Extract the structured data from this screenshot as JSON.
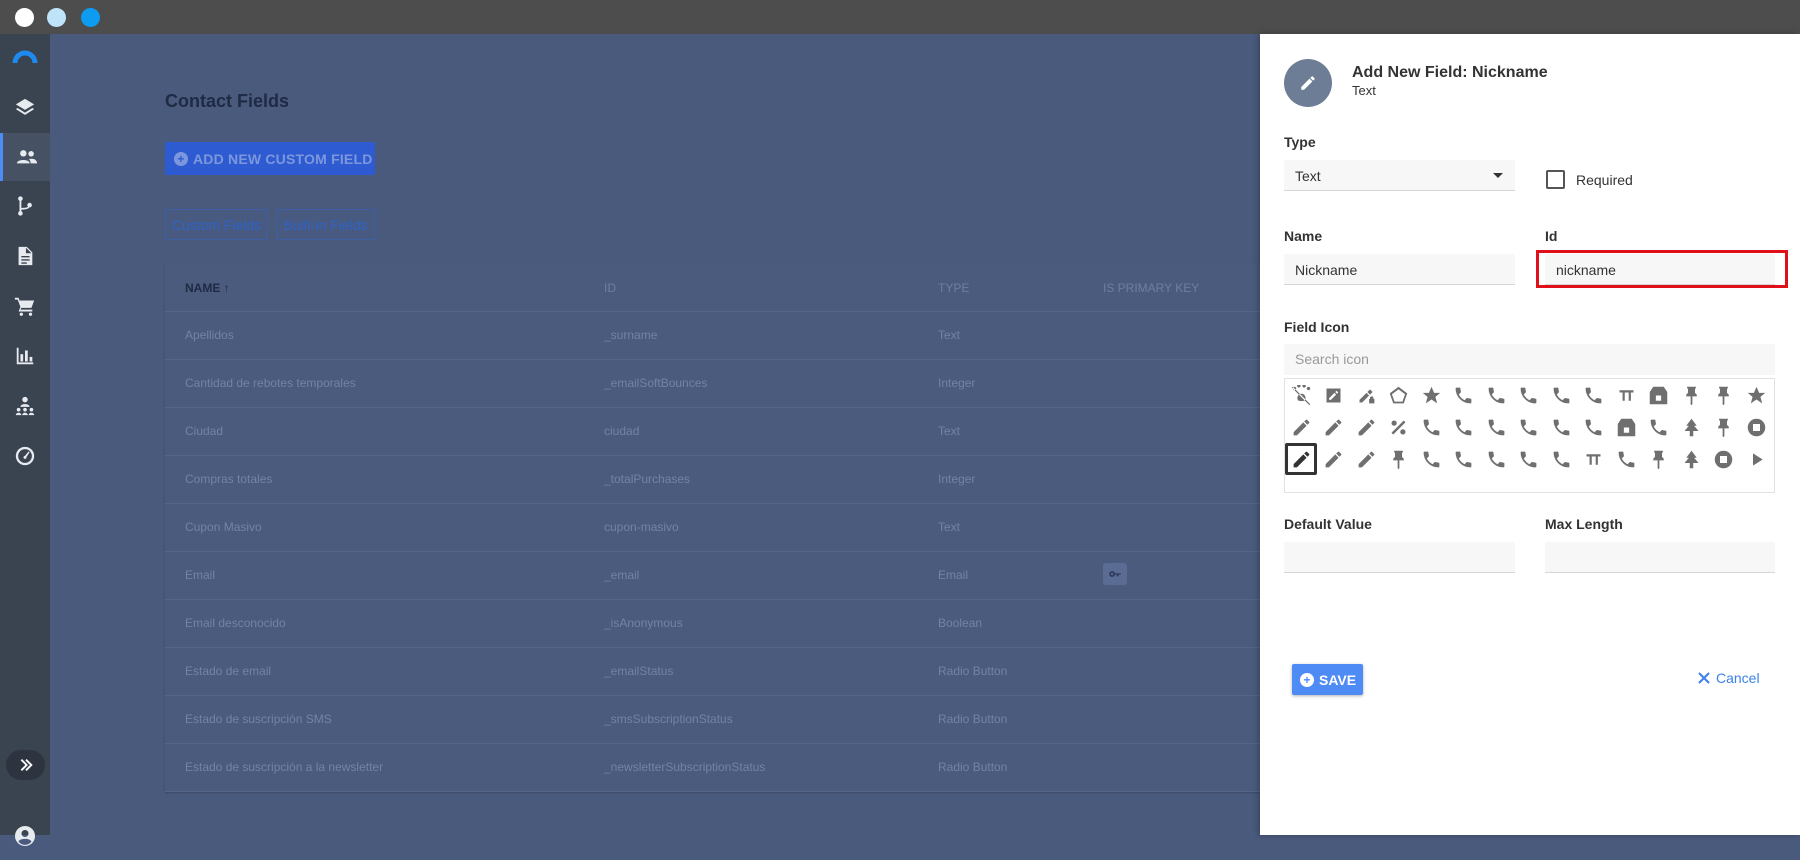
{
  "window": {
    "controls": [
      "close",
      "minimize",
      "maximize"
    ]
  },
  "sidebar": {
    "items": [
      {
        "name": "brand-logo",
        "icon": "logo-arc"
      },
      {
        "name": "sidebar-item-layers",
        "icon": "layers-icon"
      },
      {
        "name": "sidebar-item-contacts",
        "icon": "people-icon",
        "active": true
      },
      {
        "name": "sidebar-item-flows",
        "icon": "branch-icon"
      },
      {
        "name": "sidebar-item-documents",
        "icon": "document-icon"
      },
      {
        "name": "sidebar-item-shop",
        "icon": "cart-icon"
      },
      {
        "name": "sidebar-item-reports",
        "icon": "bar-chart-icon"
      },
      {
        "name": "sidebar-item-audience",
        "icon": "audience-icon"
      },
      {
        "name": "sidebar-item-dashboard",
        "icon": "gauge-icon"
      }
    ]
  },
  "page": {
    "title": "Contact Fields",
    "add_button": "ADD NEW CUSTOM FIELD",
    "tabs": [
      "Custom Fields",
      "Built-in Fields"
    ]
  },
  "table": {
    "headers": {
      "name": "NAME",
      "id": "ID",
      "type": "TYPE",
      "primary": "IS PRIMARY KEY"
    },
    "rows": [
      {
        "name": "Apellidos",
        "id": "_surname",
        "type": "Text",
        "primary": false
      },
      {
        "name": "Cantidad de rebotes temporales",
        "id": "_emailSoftBounces",
        "type": "Integer",
        "primary": false
      },
      {
        "name": "Ciudad",
        "id": "ciudad",
        "type": "Text",
        "primary": false
      },
      {
        "name": "Compras totales",
        "id": "_totalPurchases",
        "type": "Integer",
        "primary": false
      },
      {
        "name": "Cupon Masivo",
        "id": "cupon-masivo",
        "type": "Text",
        "primary": false
      },
      {
        "name": "Email",
        "id": "_email",
        "type": "Email",
        "primary": true
      },
      {
        "name": "Email desconocido",
        "id": "_isAnonymous",
        "type": "Boolean",
        "primary": false
      },
      {
        "name": "Estado de email",
        "id": "_emailStatus",
        "type": "Radio Button",
        "primary": false
      },
      {
        "name": "Estado de suscripción SMS",
        "id": "_smsSubscriptionStatus",
        "type": "Radio Button",
        "primary": false
      },
      {
        "name": "Estado de suscripción a la newsletter",
        "id": "_newsletterSubscriptionStatus",
        "type": "Radio Button",
        "primary": false
      }
    ]
  },
  "panel": {
    "title": "Add New Field: Nickname",
    "subtitle": "Text",
    "type_label": "Type",
    "type_value": "Text",
    "required_label": "Required",
    "name_label": "Name",
    "name_value": "Nickname",
    "id_label": "Id",
    "id_value": "nickname",
    "field_icon_label": "Field Icon",
    "search_placeholder": "Search icon",
    "icons": [
      "pets-off",
      "edit-box",
      "pen-lock",
      "pentagon-outline",
      "passport",
      "phone-classic",
      "phone-sync",
      "phone-log",
      "phone-outgoing",
      "phone-in-talk",
      "pi-box",
      "pill",
      "pin-off",
      "pinterest",
      "pizza",
      "partial",
      "pen",
      "edit-box-outline",
      "pen-off",
      "percent",
      "phone",
      "phone-forward",
      "phone-incoming",
      "phone-minus",
      "phone-paused",
      "phone-voip",
      "piano",
      "pillar",
      "pine-tree",
      "pinterest-box",
      "police-badge",
      "partial",
      "pencil",
      "pencil-off",
      "pentagon",
      "pin-marker",
      "phone-bluetooth",
      "phone-hangup",
      "phone-lock",
      "phone-missed",
      "phone-plus",
      "pi",
      "piggy-bank",
      "pin",
      "pine-tree-box",
      "pistol",
      "play",
      "partial"
    ],
    "selected_icon": "pencil",
    "default_value_label": "Default Value",
    "max_length_label": "Max Length",
    "save_label": "SAVE",
    "cancel_label": "Cancel",
    "highlight_color": "#e0101a",
    "accent_color": "#4e8bf5"
  }
}
